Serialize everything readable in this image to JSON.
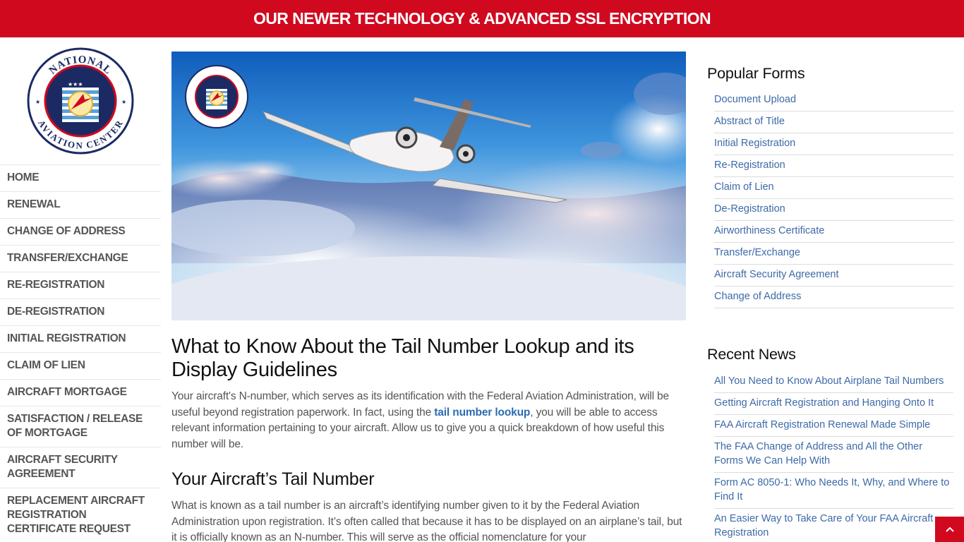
{
  "banner": {
    "text": "OUR NEWER TECHNOLOGY & ADVANCED SSL ENCRYPTION"
  },
  "logo": {
    "top_text": "NATIONAL",
    "bottom_text": "AVIATION CENTER",
    "alt": "National Aviation Center logo"
  },
  "nav": {
    "items": [
      {
        "label": "HOME"
      },
      {
        "label": "RENEWAL"
      },
      {
        "label": "CHANGE OF ADDRESS"
      },
      {
        "label": "TRANSFER/EXCHANGE"
      },
      {
        "label": "RE-REGISTRATION"
      },
      {
        "label": "DE-REGISTRATION"
      },
      {
        "label": "INITIAL REGISTRATION"
      },
      {
        "label": "CLAIM OF LIEN"
      },
      {
        "label": "AIRCRAFT MORTGAGE"
      },
      {
        "label": "SATISFACTION / RELEASE OF MORTGAGE"
      },
      {
        "label": "AIRCRAFT SECURITY AGREEMENT"
      },
      {
        "label": "REPLACEMENT AIRCRAFT REGISTRATION CERTIFICATE REQUEST"
      }
    ]
  },
  "article": {
    "title": "What to Know About the Tail Number Lookup and its Display Guidelines",
    "intro_before_link": "Your aircraft's N-number, which serves as its identification with the Federal Aviation Administration, will be useful beyond registration paperwork. In fact, using the ",
    "intro_link": "tail number lookup",
    "intro_after_link": ", you will be able to access relevant information pertaining to your aircraft. Allow us to give you a quick breakdown of how useful this number will be.",
    "section_title": "Your Aircraft’s Tail Number",
    "section_para": "What is known as a tail number is an aircraft’s identifying number given to it by the Federal Aviation Administration upon registration. It’s often called that because it has to be displayed on an airplane’s tail, but it is officially known as an N-number. This will serve as the official nomenclature for your"
  },
  "popular_forms": {
    "title": "Popular Forms",
    "items": [
      {
        "label": "Document Upload"
      },
      {
        "label": "Abstract of Title"
      },
      {
        "label": "Initial Registration"
      },
      {
        "label": "Re-Registration"
      },
      {
        "label": "Claim of Lien"
      },
      {
        "label": "De-Registration"
      },
      {
        "label": "Airworthiness Certificate"
      },
      {
        "label": "Transfer/Exchange"
      },
      {
        "label": "Aircraft Security Agreement"
      },
      {
        "label": "Change of Address"
      }
    ]
  },
  "recent_news": {
    "title": "Recent News",
    "items": [
      {
        "label": "All You Need to Know About Airplane Tail Numbers"
      },
      {
        "label": "Getting Aircraft Registration and Hanging Onto It"
      },
      {
        "label": "FAA Aircraft Registration Renewal Made Simple"
      },
      {
        "label": "The FAA Change of Address and All the Other Forms We Can Help With"
      },
      {
        "label": "Form AC 8050-1: Who Needs It, Why, and Where to Find It"
      },
      {
        "label": "An Easier Way to Take Care of Your FAA Aircraft Registration"
      }
    ]
  },
  "back_to_top": {
    "icon": "chevron-up-icon"
  },
  "colors": {
    "brand_red": "#d0091f",
    "link_blue": "#3d6aa8",
    "inline_link": "#2b6cb0",
    "navy": "#1c2a63"
  }
}
